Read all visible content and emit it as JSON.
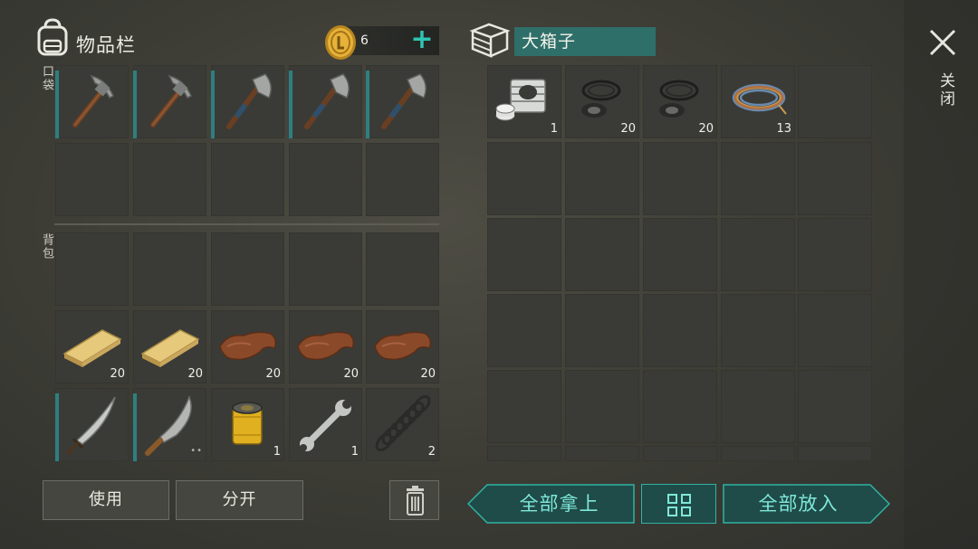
{
  "inventory": {
    "title": "物品栏",
    "coins": "6",
    "pocket_label": "口袋",
    "backpack_label": "背包",
    "pocket_slots": [
      {
        "item": "pickaxe",
        "icon": "pickaxe-icon",
        "qty": "",
        "durability": true
      },
      {
        "item": "pickaxe",
        "icon": "pickaxe-icon",
        "qty": "",
        "durability": true
      },
      {
        "item": "hatchet",
        "icon": "hatchet-icon",
        "qty": "",
        "durability": true
      },
      {
        "item": "hatchet",
        "icon": "hatchet-icon",
        "qty": "",
        "durability": true
      },
      {
        "item": "hatchet",
        "icon": "hatchet-icon",
        "qty": "",
        "durability": true
      },
      {
        "item": "",
        "icon": "",
        "qty": ""
      },
      {
        "item": "",
        "icon": "",
        "qty": ""
      },
      {
        "item": "",
        "icon": "",
        "qty": ""
      },
      {
        "item": "",
        "icon": "",
        "qty": ""
      },
      {
        "item": "",
        "icon": "",
        "qty": ""
      }
    ],
    "backpack_slots": [
      {
        "item": "",
        "icon": "",
        "qty": ""
      },
      {
        "item": "",
        "icon": "",
        "qty": ""
      },
      {
        "item": "",
        "icon": "",
        "qty": ""
      },
      {
        "item": "",
        "icon": "",
        "qty": ""
      },
      {
        "item": "",
        "icon": "",
        "qty": ""
      },
      {
        "item": "plank",
        "icon": "plank-icon",
        "qty": "20"
      },
      {
        "item": "plank",
        "icon": "plank-icon",
        "qty": "20"
      },
      {
        "item": "leather",
        "icon": "leather-icon",
        "qty": "20"
      },
      {
        "item": "leather",
        "icon": "leather-icon",
        "qty": "20"
      },
      {
        "item": "leather",
        "icon": "leather-icon",
        "qty": "20"
      },
      {
        "item": "sword",
        "icon": "sword-icon",
        "qty": "",
        "durability": true
      },
      {
        "item": "machete",
        "icon": "machete-icon",
        "qty": "",
        "durability": true,
        "dots": "••"
      },
      {
        "item": "filter",
        "icon": "oil-filter-icon",
        "qty": "1"
      },
      {
        "item": "wrench",
        "icon": "wrench-icon",
        "qty": "1"
      },
      {
        "item": "spring",
        "icon": "spring-icon",
        "qty": "2"
      }
    ],
    "buttons": {
      "use": "使用",
      "split": "分开"
    }
  },
  "box": {
    "title": "大箱子",
    "slots": [
      {
        "item": "engine-cylinder",
        "icon": "cylinder-icon",
        "qty": "1"
      },
      {
        "item": "rubber-seal",
        "icon": "seal-icon",
        "qty": "20"
      },
      {
        "item": "rubber-seal",
        "icon": "seal-icon",
        "qty": "20"
      },
      {
        "item": "wire",
        "icon": "wire-icon",
        "qty": "13"
      }
    ],
    "buttons": {
      "take_all": "全部拿上",
      "put_all": "全部放入"
    }
  },
  "close_label": "关闭",
  "colors": {
    "accent": "#2fc4b2",
    "durability": "#2e7f80",
    "box_title_bg": "#2f6f6a"
  }
}
